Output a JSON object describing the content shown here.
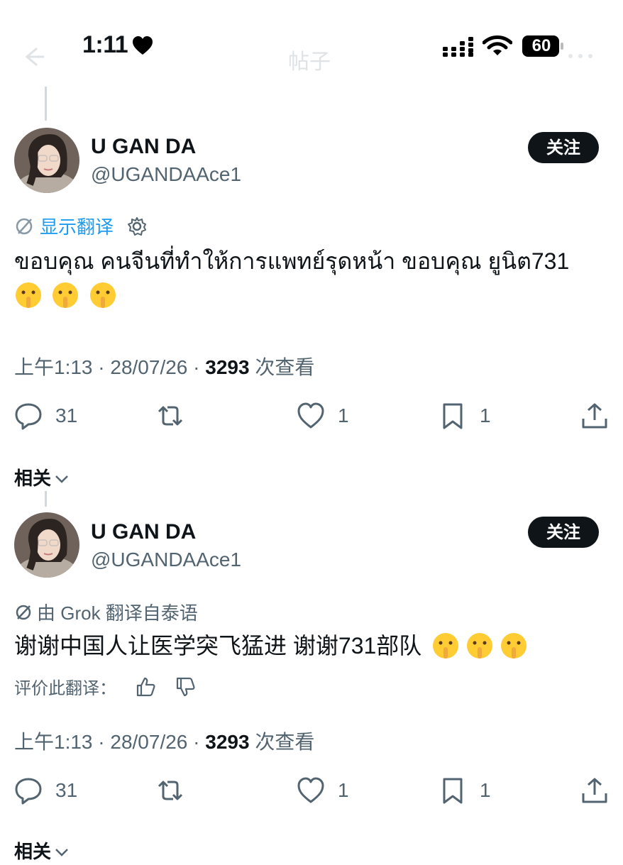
{
  "status_bar": {
    "time": "1:11",
    "battery": "60"
  },
  "header": {
    "title": "帖子"
  },
  "posts": [
    {
      "display_name": "U GAN DA",
      "handle": "@UGANDAAce1",
      "follow_label": "关注",
      "translate_label": "显示翻译",
      "text": "ขอบคุณ คนจีนที่ทำให้การแพทย์รุดหน้า ขอบคุณ ยูนิต731",
      "emoji_count": 3,
      "meta_time": "上午1:13 · 28/07/26 · ",
      "views": "3293",
      "views_label": " 次查看",
      "replies": "31",
      "likes": "1",
      "bookmarks": "1"
    },
    {
      "display_name": "U GAN DA",
      "handle": "@UGANDAAce1",
      "follow_label": "关注",
      "translated_by_label": "由 Grok 翻译自泰语",
      "text": "谢谢中国人让医学突飞猛进 谢谢731部队",
      "emoji_count": 3,
      "rate_label": "评价此翻译：",
      "meta_time": "上午1:13 · 28/07/26 · ",
      "views": "3293",
      "views_label": " 次查看",
      "replies": "31",
      "likes": "1",
      "bookmarks": "1"
    }
  ],
  "related_label": "相关",
  "colors": {
    "text": "#0f1419",
    "secondary": "#536471",
    "accent": "#1d9bf0",
    "button": "#0f1419"
  },
  "icons": [
    "heart-icon",
    "signal-icon",
    "wifi-icon",
    "battery-icon",
    "reply-icon",
    "repost-icon",
    "like-icon",
    "bookmark-icon",
    "share-icon",
    "translate-icon",
    "settings-icon",
    "thumbs-up-icon",
    "thumbs-down-icon",
    "chevron-down-icon",
    "shushing-face-emoji"
  ]
}
